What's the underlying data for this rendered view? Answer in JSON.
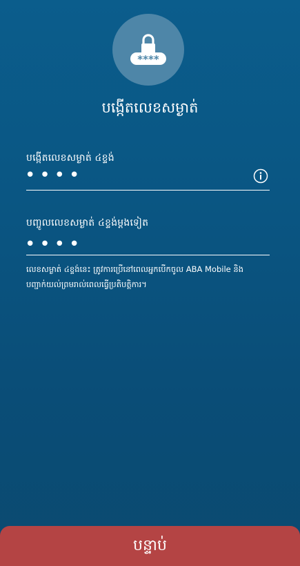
{
  "header": {
    "icon": "lock-pin-icon",
    "pin_mask_text": "****",
    "title": "បង្កើតលេខសម្ងាត់"
  },
  "create_pin": {
    "label": "បង្កើតលេខសម្ងាត់ ៤ខ្ទង់",
    "value": "••••",
    "info_icon": "info-icon"
  },
  "confirm_pin": {
    "label": "បញ្ចូលលេខសម្ងាត់ ៤ខ្ទង់ម្តងទៀត",
    "value": "••••"
  },
  "note": {
    "line1": "លេខសម្ងាត់ ៤ខ្ទង់នេះ ត្រូវការប្រើនៅពេលអ្នកបើកចូល ABA Mobile និង",
    "line2": "បញ្ជាក់យល់ព្រមរាល់ពេលធ្វើប្រតិបត្តិការ។"
  },
  "footer": {
    "next_label": "បន្ទាប់"
  },
  "colors": {
    "background": "#0a5683",
    "button": "#b44444",
    "badge": "#4e86a8"
  }
}
